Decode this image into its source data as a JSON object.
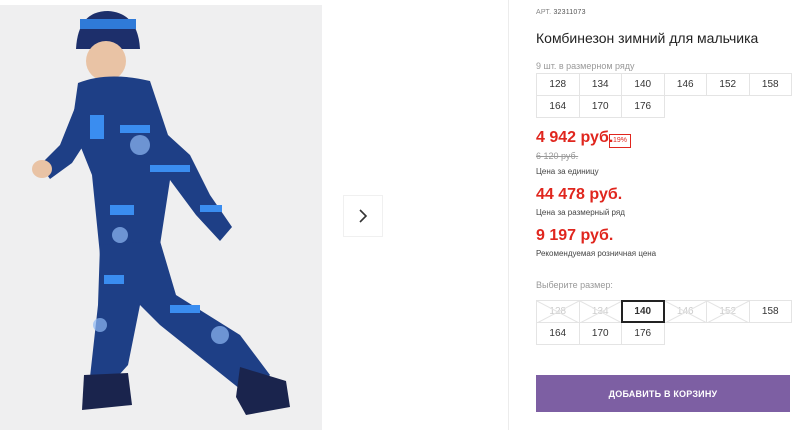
{
  "product": {
    "sku_label": "АРТ.",
    "sku_value": "32311073",
    "title": "Комбинезон зимний для мальчика",
    "pack_caption": "9 шт. в размерном ряду",
    "pack_sizes": [
      "128",
      "134",
      "140",
      "146",
      "152",
      "158",
      "164",
      "170",
      "176"
    ]
  },
  "prices": {
    "unit_price": "4 942 руб.",
    "discount": "19%",
    "old_price": "6 120 руб.",
    "unit_label": "Цена за единицу",
    "pack_price": "44 478 руб.",
    "pack_label": "Цена за размерный ряд",
    "rrp_price": "9 197 руб.",
    "rrp_label": "Рекомендуемая розничная цена"
  },
  "size_select": {
    "label": "Выберите размер:",
    "selected": "140",
    "options": [
      {
        "size": "128",
        "available": false
      },
      {
        "size": "134",
        "available": false
      },
      {
        "size": "140",
        "available": true
      },
      {
        "size": "146",
        "available": false
      },
      {
        "size": "152",
        "available": false
      },
      {
        "size": "158",
        "available": true
      },
      {
        "size": "164",
        "available": true
      },
      {
        "size": "170",
        "available": true
      },
      {
        "size": "176",
        "available": true
      }
    ]
  },
  "cart_button": "ДОБАВИТЬ В КОРЗИНУ",
  "colors": {
    "price_red": "#e0261e",
    "button_purple": "#7d5fa3"
  },
  "icons": {
    "gallery_next": "chevron-right-icon"
  }
}
